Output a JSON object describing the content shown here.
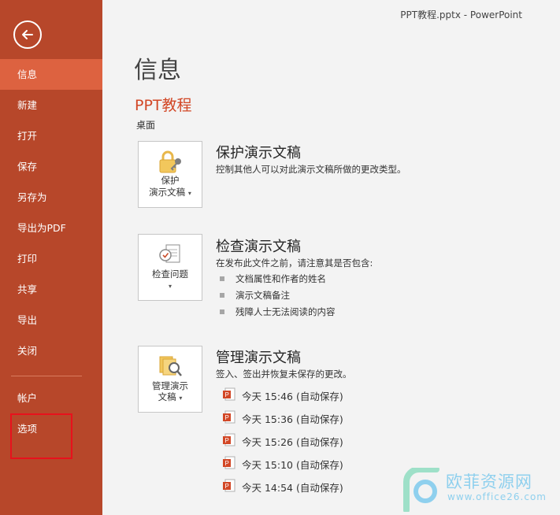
{
  "window": {
    "title": "PPT教程.pptx - PowerPoint"
  },
  "sidebar": {
    "items": [
      {
        "label": "信息",
        "active": true
      },
      {
        "label": "新建"
      },
      {
        "label": "打开"
      },
      {
        "label": "保存"
      },
      {
        "label": "另存为"
      },
      {
        "label": "导出为PDF"
      },
      {
        "label": "打印"
      },
      {
        "label": "共享"
      },
      {
        "label": "导出"
      },
      {
        "label": "关闭"
      }
    ],
    "bottom_items": [
      {
        "label": "帐户"
      },
      {
        "label": "选项"
      }
    ]
  },
  "main": {
    "title": "信息",
    "doc_name": "PPT教程",
    "location": "桌面",
    "protect": {
      "tile_line1": "保护",
      "tile_line2": "演示文稿",
      "title": "保护演示文稿",
      "desc": "控制其他人可以对此演示文稿所做的更改类型。"
    },
    "inspect": {
      "tile_line1": "检查问题",
      "title": "检查演示文稿",
      "desc": "在发布此文件之前，请注意其是否包含:",
      "bullets": [
        "文档属性和作者的姓名",
        "演示文稿备注",
        "残障人士无法阅读的内容"
      ]
    },
    "manage": {
      "tile_line1": "管理演示",
      "tile_line2": "文稿",
      "title": "管理演示文稿",
      "desc": "签入、签出并恢复未保存的更改。",
      "versions": [
        "今天 15:46 (自动保存)",
        "今天 15:36 (自动保存)",
        "今天 15:26 (自动保存)",
        "今天 15:10 (自动保存)",
        "今天 14:54 (自动保存)"
      ]
    }
  },
  "watermark": {
    "text": "欧菲资源网",
    "url": "www.office26.com"
  },
  "colors": {
    "sidebar": "#b7472a",
    "active": "#dd6240",
    "accent": "#d24726"
  }
}
